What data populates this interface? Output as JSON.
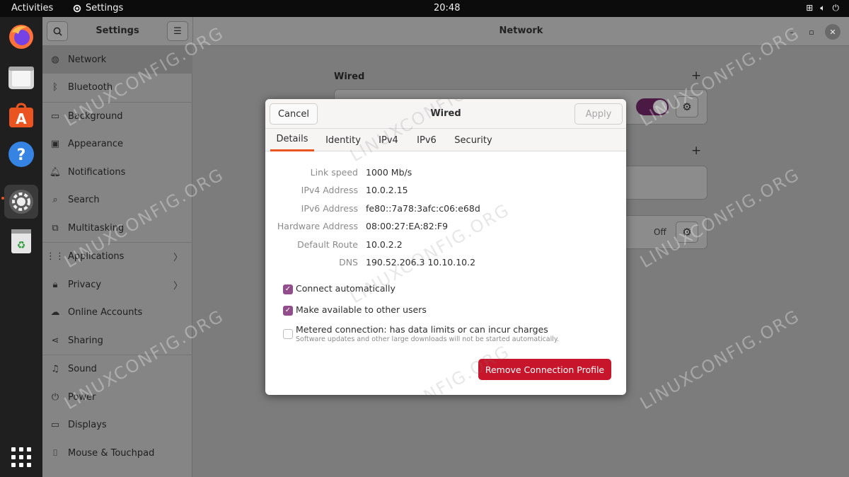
{
  "topbar": {
    "activities": "Activities",
    "app_name": "Settings",
    "clock": "20:48"
  },
  "dock": {
    "items": [
      "firefox-icon",
      "files-icon",
      "software-store-icon",
      "help-icon",
      "settings-icon",
      "trash-icon"
    ],
    "apps_grid": "show-apps-icon"
  },
  "sidebar": {
    "title": "Settings",
    "items": [
      {
        "label": "Network",
        "icon": "globe-icon"
      },
      {
        "label": "Bluetooth",
        "icon": "bluetooth-icon"
      },
      {
        "label": "Background",
        "icon": "background-icon"
      },
      {
        "label": "Appearance",
        "icon": "appearance-icon"
      },
      {
        "label": "Notifications",
        "icon": "bell-icon"
      },
      {
        "label": "Search",
        "icon": "search-icon"
      },
      {
        "label": "Multitasking",
        "icon": "multitasking-icon"
      },
      {
        "label": "Applications",
        "icon": "apps-icon"
      },
      {
        "label": "Privacy",
        "icon": "lock-icon"
      },
      {
        "label": "Online Accounts",
        "icon": "cloud-icon"
      },
      {
        "label": "Sharing",
        "icon": "share-icon"
      },
      {
        "label": "Sound",
        "icon": "music-note-icon"
      },
      {
        "label": "Power",
        "icon": "power-icon"
      },
      {
        "label": "Displays",
        "icon": "display-icon"
      },
      {
        "label": "Mouse & Touchpad",
        "icon": "mouse-icon"
      }
    ]
  },
  "main": {
    "title": "Network",
    "wired_label": "Wired",
    "off_label": "Off"
  },
  "dialog": {
    "title": "Wired",
    "cancel": "Cancel",
    "apply": "Apply",
    "tabs": [
      "Details",
      "Identity",
      "IPv4",
      "IPv6",
      "Security"
    ],
    "details": [
      {
        "key": "Link speed",
        "value": "1000 Mb/s"
      },
      {
        "key": "IPv4 Address",
        "value": "10.0.2.15"
      },
      {
        "key": "IPv6 Address",
        "value": "fe80::7a78:3afc:c06:e68d"
      },
      {
        "key": "Hardware Address",
        "value": "08:00:27:EA:82:F9"
      },
      {
        "key": "Default Route",
        "value": "10.0.2.2"
      },
      {
        "key": "DNS",
        "value": "190.52.206.3 10.10.10.2"
      }
    ],
    "checks": [
      {
        "label": "Connect automatically",
        "checked": true
      },
      {
        "label": "Make available to other users",
        "checked": true
      },
      {
        "label": "Metered connection: has data limits or can incur charges",
        "sub": "Software updates and other large downloads will not be started automatically.",
        "checked": false
      }
    ],
    "remove": "Remove Connection Profile"
  },
  "watermark": "LINUXCONFIG.ORG",
  "colors": {
    "accent": "#e95420",
    "checkbox": "#924d8b",
    "destructive": "#c7162b"
  }
}
